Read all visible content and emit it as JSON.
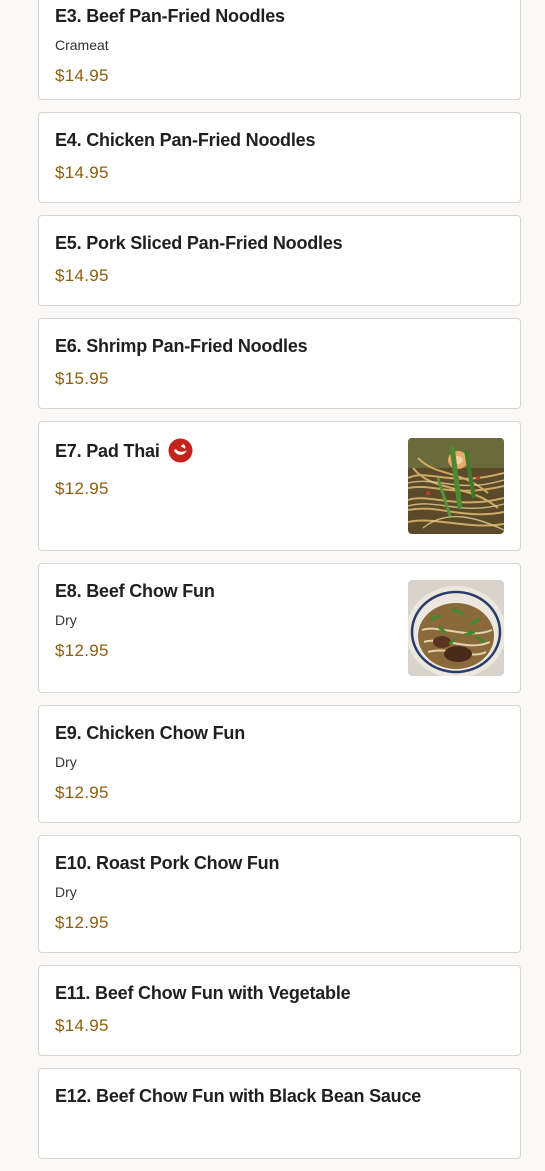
{
  "menu": {
    "items": [
      {
        "title": "E3. Beef Pan-Fried Noodles",
        "desc": "Crameat",
        "price": "$14.95"
      },
      {
        "title": "E4. Chicken Pan-Fried Noodles",
        "price": "$14.95"
      },
      {
        "title": "E5. Pork Sliced Pan-Fried Noodles",
        "price": "$14.95"
      },
      {
        "title": "E6. Shrimp Pan-Fried Noodles",
        "price": "$15.95"
      },
      {
        "title": "E7. Pad Thai",
        "price": "$12.95",
        "icon": "spicy-pepper-icon",
        "image": "pad-thai-photo"
      },
      {
        "title": "E8. Beef Chow Fun",
        "desc": "Dry",
        "price": "$12.95",
        "image": "beef-chow-fun-photo"
      },
      {
        "title": "E9. Chicken Chow Fun",
        "desc": "Dry",
        "price": "$12.95"
      },
      {
        "title": "E10. Roast Pork Chow Fun",
        "desc": "Dry",
        "price": "$12.95"
      },
      {
        "title": "E11. Beef Chow Fun with Vegetable",
        "price": "$14.95"
      },
      {
        "title": "E12. Beef Chow Fun with Black Bean Sauce"
      }
    ]
  },
  "colors": {
    "background": "#faf9f7",
    "card": "#ffffff",
    "border": "#d5d5d5",
    "price": "#8b5e0f",
    "spicy_icon": "#c4231c"
  }
}
